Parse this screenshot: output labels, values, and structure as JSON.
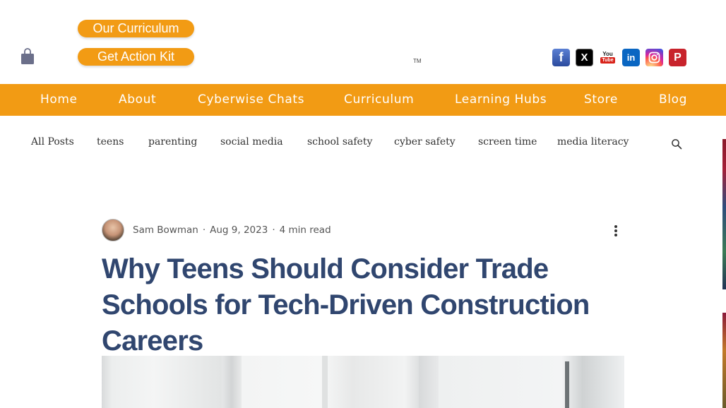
{
  "header": {
    "buttons": {
      "curriculum": "Our Curriculum",
      "action_kit": "Get Action Kit"
    },
    "trademark": "TM",
    "socials": [
      {
        "name": "facebook",
        "glyph": "f"
      },
      {
        "name": "x",
        "glyph": "X"
      },
      {
        "name": "youtube",
        "glyph_top": "You",
        "glyph_bottom": "Tube"
      },
      {
        "name": "linkedin",
        "glyph": "in"
      },
      {
        "name": "instagram",
        "glyph": ""
      },
      {
        "name": "pinterest",
        "glyph": "P"
      }
    ]
  },
  "nav": {
    "items": [
      "Home",
      "About",
      "Cyberwise Chats",
      "Curriculum",
      "Learning Hubs",
      "Store",
      "Blog"
    ]
  },
  "categories": [
    "All Posts",
    "teens",
    "parenting",
    "social media",
    "school safety",
    "cyber safety",
    "screen time",
    "media literacy"
  ],
  "post": {
    "author": "Sam Bowman",
    "date": "Aug 9, 2023",
    "read_time": "4 min read",
    "separator": "·",
    "title": "Why Teens Should Consider Trade Schools for Tech-Driven Construction Careers"
  },
  "colors": {
    "accent": "#f29b14",
    "title": "#30466f"
  }
}
